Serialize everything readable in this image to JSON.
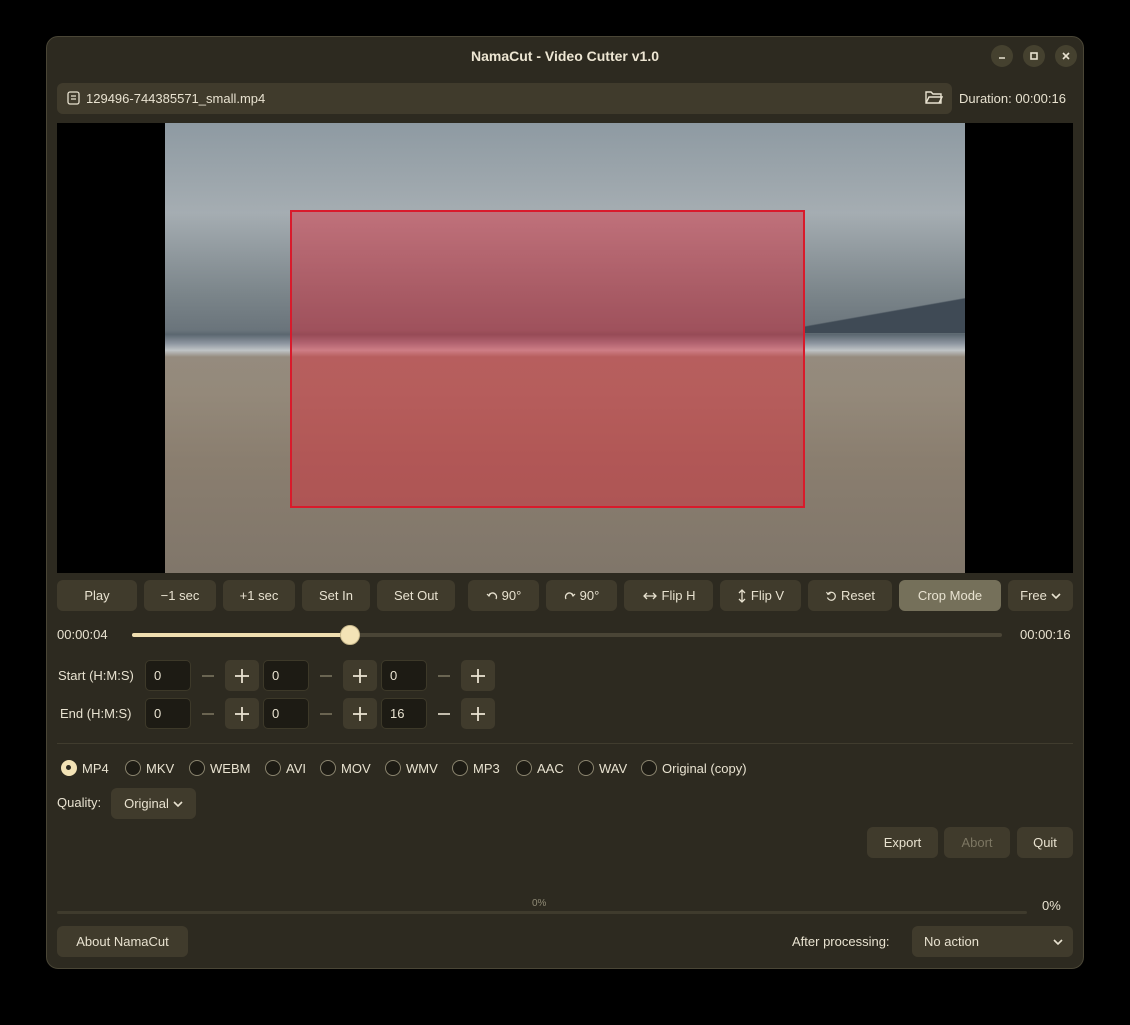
{
  "window": {
    "title": "NamaCut - Video Cutter v1.0"
  },
  "file": {
    "name": "129496-744385571_small.mp4",
    "duration": "Duration: 00:00:16"
  },
  "controls": {
    "play": "Play",
    "minus_sec": "−1 sec",
    "plus_sec": "+1 sec",
    "set_in": "Set In",
    "set_out": "Set Out",
    "rotate_left": "90°",
    "rotate_right": "90°",
    "flip_h": "Flip H",
    "flip_v": "Flip V",
    "reset": "Reset",
    "crop_mode": "Crop Mode",
    "aspect": "Free"
  },
  "timeline": {
    "current": "00:00:04",
    "end": "00:00:16",
    "position_fraction": 0.25
  },
  "start": {
    "label": "Start (H:M:S)",
    "h": "0",
    "m": "0",
    "s": "0"
  },
  "end": {
    "label": "End (H:M:S)",
    "h": "0",
    "m": "0",
    "s": "16"
  },
  "formats": [
    "MP4",
    "MKV",
    "WEBM",
    "AVI",
    "MOV",
    "WMV",
    "MP3",
    "AAC",
    "WAV",
    "Original (copy)"
  ],
  "selected_format": "MP4",
  "quality": {
    "label": "Quality:",
    "value": "Original"
  },
  "actions": {
    "export": "Export",
    "abort": "Abort",
    "quit": "Quit"
  },
  "progress": {
    "bar_text": "0%",
    "percent": "0%",
    "value": 0
  },
  "footer": {
    "about": "About NamaCut",
    "after_label": "After processing:",
    "after_value": "No action"
  },
  "colors": {
    "accent": "#f3e3b6",
    "crop_overlay": "#d91a2b",
    "window_bg": "#2d2a20"
  }
}
